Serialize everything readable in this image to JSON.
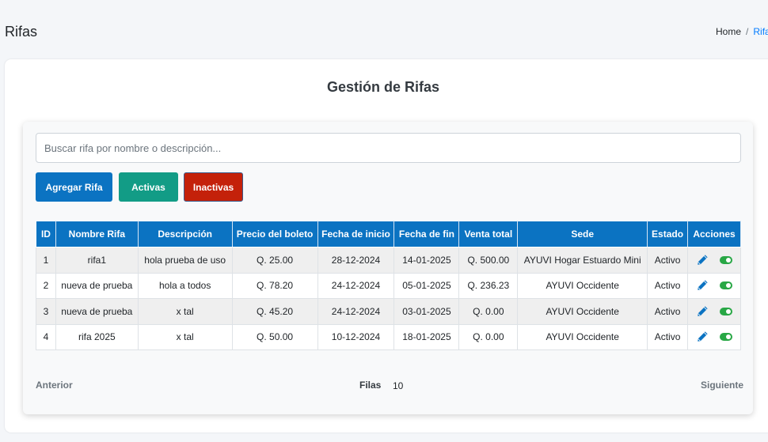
{
  "header": {
    "title": "Rifas",
    "breadcrumb": {
      "home": "Home",
      "separator": "/",
      "current": "Rifas"
    }
  },
  "card": {
    "title": "Gestión de Rifas"
  },
  "search": {
    "placeholder": "Buscar rifa por nombre o descripción...",
    "value": ""
  },
  "buttons": {
    "add": "Agregar Rifa",
    "active": "Activas",
    "inactive": "Inactivas"
  },
  "table": {
    "columns": [
      "ID",
      "Nombre Rifa",
      "Descripción",
      "Precio del boleto",
      "Fecha de inicio",
      "Fecha de fin",
      "Venta total",
      "Sede",
      "Estado",
      "Acciones"
    ],
    "rows": [
      {
        "id": "1",
        "nombre": "rifa1",
        "descripcion": "hola prueba de uso",
        "precio": "Q. 25.00",
        "inicio": "28-12-2024",
        "fin": "14-01-2025",
        "venta": "Q. 500.00",
        "sede": "AYUVI Hogar Estuardo Mini",
        "estado": "Activo"
      },
      {
        "id": "2",
        "nombre": "nueva de prueba",
        "descripcion": "hola a todos",
        "precio": "Q. 78.20",
        "inicio": "24-12-2024",
        "fin": "05-01-2025",
        "venta": "Q. 236.23",
        "sede": "AYUVI Occidente",
        "estado": "Activo"
      },
      {
        "id": "3",
        "nombre": "nueva de prueba",
        "descripcion": "x tal",
        "precio": "Q. 45.20",
        "inicio": "24-12-2024",
        "fin": "03-01-2025",
        "venta": "Q. 0.00",
        "sede": "AYUVI Occidente",
        "estado": "Activo"
      },
      {
        "id": "4",
        "nombre": "rifa 2025",
        "descripcion": "x tal",
        "precio": "Q. 50.00",
        "inicio": "10-12-2024",
        "fin": "18-01-2025",
        "venta": "Q. 0.00",
        "sede": "AYUVI Occidente",
        "estado": "Activo"
      }
    ]
  },
  "pagination": {
    "prev": "Anterior",
    "rows_label": "Filas",
    "rows_value": "10",
    "next": "Siguiente"
  },
  "colors": {
    "primary": "#0b73c2",
    "success": "#129c86",
    "danger": "#c4210a",
    "toggle_on": "#28a745"
  },
  "icons": {
    "edit": "pencil-icon",
    "status": "toggle-on-icon"
  }
}
